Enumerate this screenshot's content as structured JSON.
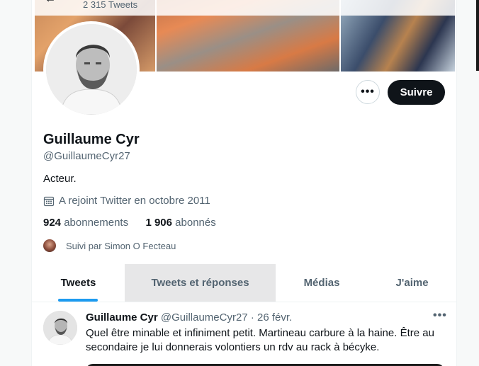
{
  "header": {
    "tweet_count": "2 315 Tweets"
  },
  "profile": {
    "name": "Guillaume Cyr",
    "handle": "@GuillaumeCyr27",
    "bio": "Acteur.",
    "joined": "A rejoint Twitter en octobre 2011",
    "following_count": "924",
    "following_label": "abonnements",
    "followers_count": "1 906",
    "followers_label": "abonnés",
    "followed_by": "Suivi par Simon O Fecteau"
  },
  "actions": {
    "more": "•••",
    "follow": "Suivre"
  },
  "tabs": [
    {
      "label": "Tweets",
      "active": true
    },
    {
      "label": "Tweets et réponses",
      "hover": true
    },
    {
      "label": "Médias"
    },
    {
      "label": "J'aime"
    }
  ],
  "tweet": {
    "author": "Guillaume Cyr",
    "handle": "@GuillaumeCyr27",
    "separator": "·",
    "date": "26 févr.",
    "more": "•••",
    "text": "Quel être minable et infiniment petit. Martineau carbure à la haine. Être au secondaire je lui donnerais volontiers un rdv au rack à bécyke."
  },
  "icons": {
    "back": "arrow-left-icon",
    "joined": "calendar-icon",
    "more": "more-dots-icon"
  },
  "colors": {
    "accent": "#1d9bf0",
    "text": "#0f1419",
    "muted": "#536471",
    "button": "#0f1419"
  }
}
